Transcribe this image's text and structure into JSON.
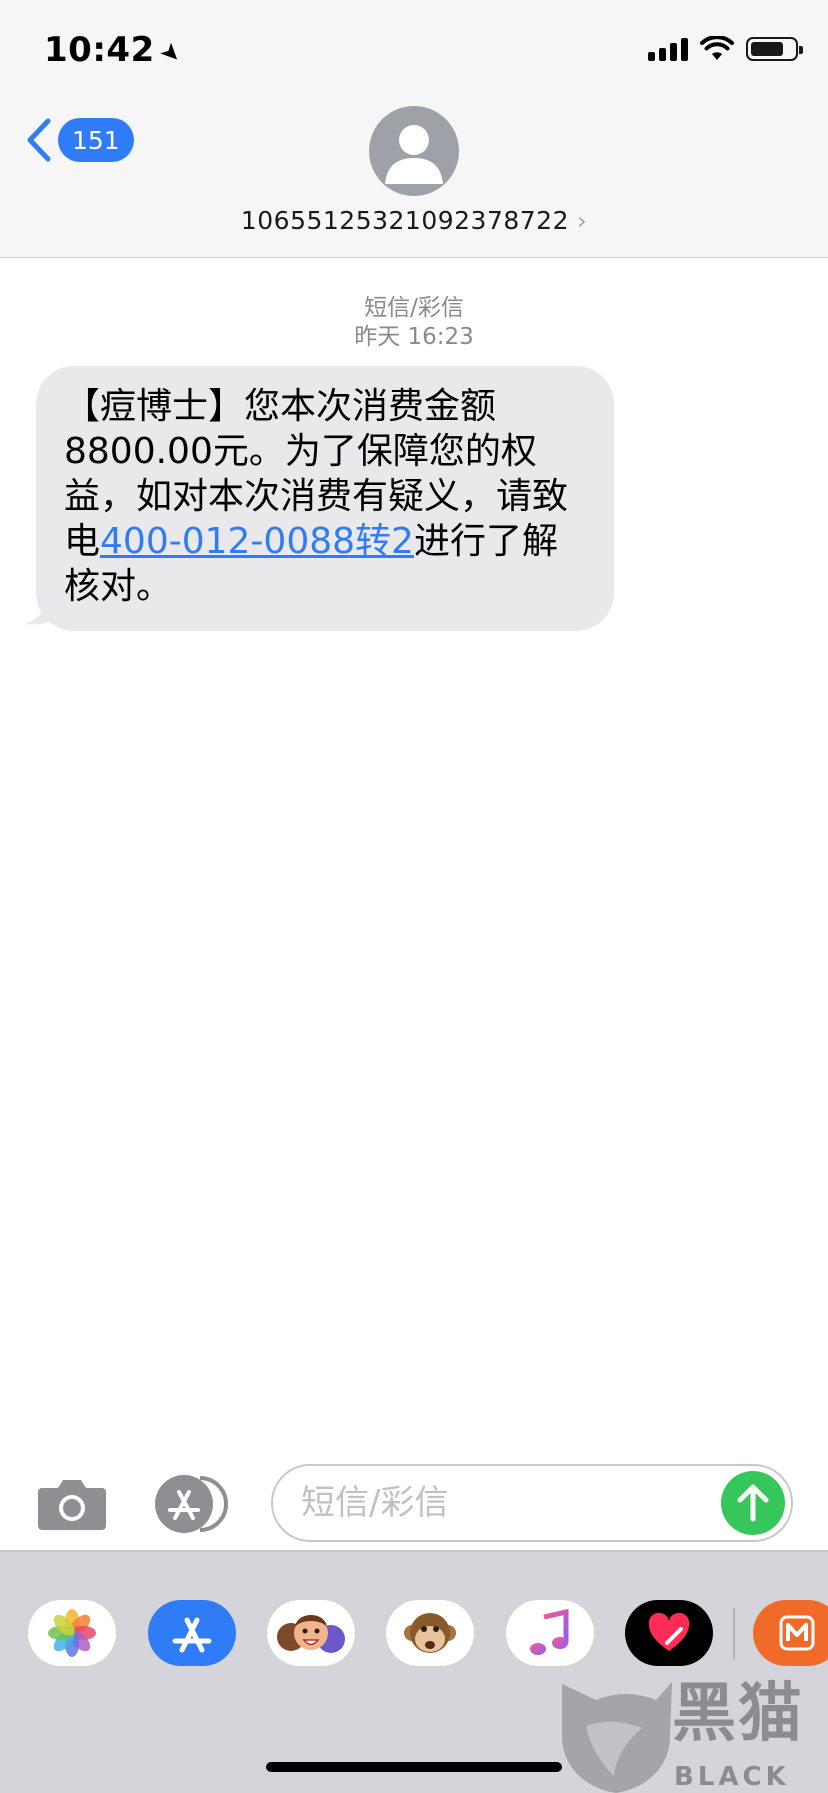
{
  "status_bar": {
    "time": "10:42",
    "location_icon": "location-arrow-icon"
  },
  "header": {
    "back_count": "151",
    "contact_number": "10655125321092378722",
    "contact_chevron": "›"
  },
  "conversation": {
    "service_label": "短信/彩信",
    "timestamp": "昨天 16:23",
    "message": {
      "text_before_link": "【痘博士】您本次消费金额8800.00元。为了保障您的权益，如对本次消费有疑义，请致电",
      "link_text": "400-012-0088转2",
      "text_after_link": "进行了解核对。"
    }
  },
  "input_bar": {
    "placeholder": "短信/彩信"
  },
  "app_drawer": {
    "apps": [
      {
        "name": "photos-app-icon"
      },
      {
        "name": "app-store-app-icon"
      },
      {
        "name": "memoji-app-icon"
      },
      {
        "name": "animoji-app-icon"
      },
      {
        "name": "music-app-icon"
      },
      {
        "name": "digital-touch-app-icon"
      },
      {
        "name": "mango-tv-app-icon"
      }
    ]
  },
  "watermark": {
    "text": "黑猫",
    "sub": "BLACK CAT"
  },
  "colors": {
    "accent": "#2f7cf6",
    "send": "#35c759",
    "bubble": "#e9e9eb"
  }
}
